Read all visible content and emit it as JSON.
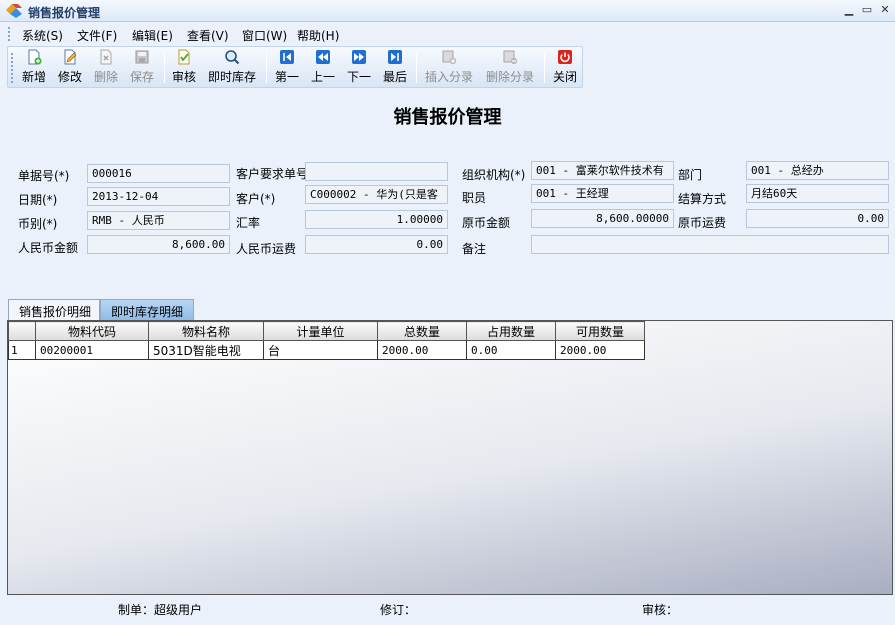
{
  "window": {
    "title": "销售报价管理"
  },
  "menu": [
    "系统(S)",
    "文件(F)",
    "编辑(E)",
    "查看(V)",
    "窗口(W)",
    "帮助(H)"
  ],
  "toolbar": {
    "new": "新增",
    "edit": "修改",
    "delete": "删除",
    "save": "保存",
    "audit": "审核",
    "stock": "即时库存",
    "first": "第一",
    "prev": "上一",
    "next": "下一",
    "last": "最后",
    "insert_entry": "插入分录",
    "delete_entry": "删除分录",
    "close": "关闭"
  },
  "form": {
    "title": "销售报价管理",
    "labels": {
      "doc_no": "单据号(*)",
      "date": "日期(*)",
      "currency": "币别(*)",
      "rmb_amount": "人民币金额",
      "customer_req_no": "客户要求单号",
      "customer": "客户(*)",
      "rate": "汇率",
      "rmb_freight": "人民币运费",
      "org": "组织机构(*)",
      "staff": "职员",
      "orig_amount": "原币金额",
      "remark": "备注",
      "dept": "部门",
      "settle": "结算方式",
      "orig_freight": "原币运费"
    },
    "values": {
      "doc_no": "000016",
      "date": "2013-12-04",
      "currency": "RMB - 人民币",
      "rmb_amount": "8,600.00",
      "customer_req_no": "",
      "customer": "C000002 - 华为(只是客",
      "rate": "1.00000",
      "rmb_freight": "0.00",
      "org": "001 - 富莱尔软件技术有",
      "staff": "001 - 王经理",
      "orig_amount": "8,600.00000",
      "remark": "",
      "dept": "001 - 总经办",
      "settle": "月结60天",
      "orig_freight": "0.00"
    }
  },
  "tabs": [
    "销售报价明细",
    "即时库存明细"
  ],
  "grid": {
    "columns": [
      "物料代码",
      "物料名称",
      "计量单位",
      "总数量",
      "占用数量",
      "可用数量"
    ],
    "rows": [
      {
        "no": "1",
        "code": "00200001",
        "name": "5031D智能电视",
        "unit": "台",
        "total": "2000.00",
        "occupied": "0.00",
        "available": "2000.00"
      }
    ]
  },
  "footer": {
    "maker": "制单：超级用户",
    "reviser": "修订：",
    "auditor": "审核："
  },
  "colors": {
    "background": "#eaf1fb",
    "close_red": "#d9261c",
    "nav_blue": "#1f6fd0"
  }
}
